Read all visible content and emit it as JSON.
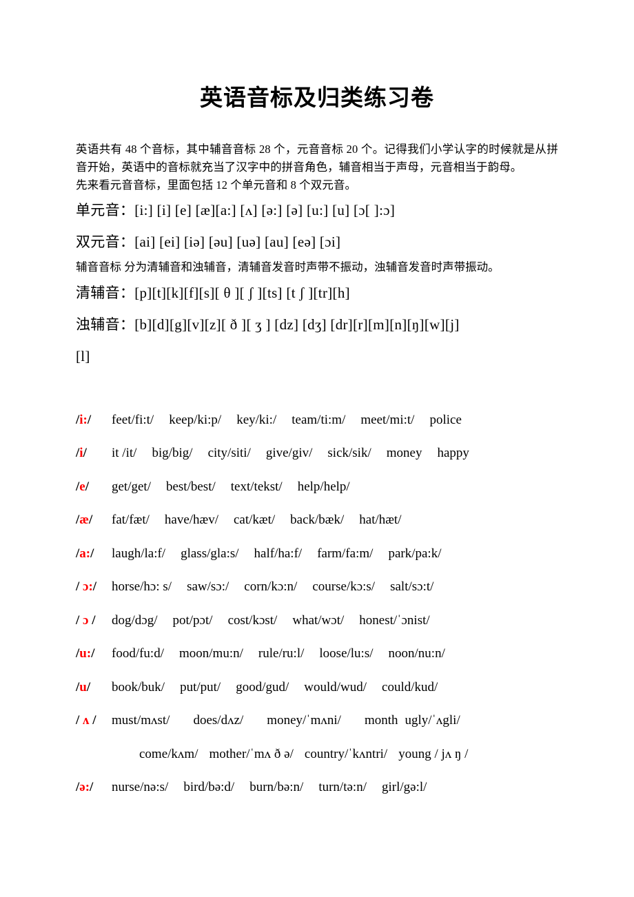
{
  "document": {
    "title": "英语音标及归类练习卷",
    "intro": [
      "英语共有 48 个音标，其中辅音音标 28 个，元音音标 20 个。记得我们小学认字的时候就是从拼音开始，英语中的音标就充当了汉字中的拼音角色，辅音相当于声母，元音相当于韵母。",
      "先来看元音音标，里面包括 12 个单元音和 8 个双元音。"
    ],
    "ipa_groups": [
      {
        "label": "单元音：",
        "symbols": "[i:]  [i]  [e]  [æ][a:]  [ʌ]  [ə:]  [ə]  [u:]  [u]  [ɔ[ ]:ɔ]"
      },
      {
        "label": "双元音：",
        "symbols": "[ai]  [ei]  [iə]  [əu]  [uə]  [au]  [eə]  [ɔi]"
      }
    ],
    "consonant_note": "辅音音标 分为清辅音和浊辅音，清辅音发音时声带不振动，浊辅音发音时声带振动。",
    "consonant_groups": [
      {
        "label": "清辅音：",
        "symbols": "[p][t][k][f][s][ θ ][ ʃ ][ts]  [t ʃ ][tr][h]"
      },
      {
        "label": "浊辅音：",
        "symbols": "[b][d][g][v][z][ ð ][ ʒ ]  [dz]  [dʒ]  [dr][r][m][n][ŋ][w][j]",
        "continuation": "[l]"
      }
    ],
    "word_rows": [
      {
        "symbol_open": "/",
        "symbol": "i:",
        "symbol_close": "/",
        "words": [
          "feet/fi:t/",
          "keep/ki:p/",
          "key/ki:/",
          "team/ti:m/",
          "meet/mi:t/",
          "police"
        ]
      },
      {
        "symbol_open": "/",
        "symbol": "i",
        "symbol_close": "/",
        "words": [
          "it /it/",
          "big/big/",
          "city/siti/",
          "give/giv/",
          "sick/sik/",
          "money",
          "happy"
        ]
      },
      {
        "symbol_open": "/",
        "symbol": "e",
        "symbol_close": "/",
        "words": [
          "get/get/",
          "best/best/",
          "text/tekst/",
          "help/help/"
        ]
      },
      {
        "symbol_open": "/",
        "symbol": "æ",
        "symbol_close": "/",
        "words": [
          "fat/fæt/",
          "have/hæv/",
          "cat/kæt/",
          "back/bæk/",
          "hat/hæt/"
        ]
      },
      {
        "symbol_open": "/",
        "symbol": "a:",
        "symbol_close": "/",
        "words": [
          "laugh/la:f/",
          "glass/gla:s/",
          "half/ha:f/",
          "farm/fa:m/",
          "park/pa:k/"
        ]
      },
      {
        "symbol_open": "/ ",
        "symbol": "ɔ:",
        "symbol_close": "/",
        "words": [
          "horse/hɔ: s/",
          "saw/sɔ:/",
          "corn/kɔ:n/",
          "course/kɔ:s/",
          "salt/sɔ:t/"
        ]
      },
      {
        "symbol_open": "/ ",
        "symbol": "ɔ",
        "symbol_close": " /",
        "words": [
          "dog/dɔg/",
          "pot/pɔt/",
          "cost/kɔst/",
          "what/wɔt/",
          "honest/ˈɔnist/"
        ]
      },
      {
        "symbol_open": "/",
        "symbol": "u:",
        "symbol_close": "/",
        "words": [
          "food/fu:d/",
          "moon/mu:n/",
          "rule/ru:l/",
          "loose/lu:s/",
          "noon/nu:n/"
        ]
      },
      {
        "symbol_open": "/",
        "symbol": "u",
        "symbol_close": "/",
        "words": [
          "book/buk/",
          "put/put/",
          "good/gud/",
          "would/wud/",
          "could/kud/"
        ]
      },
      {
        "symbol_open": "/ ",
        "symbol": "ʌ",
        "symbol_close": " /",
        "words": [
          "must/mʌst/",
          "does/dʌz/",
          "money/ˈmʌni/",
          "month",
          "ugly/ˈʌgli/"
        ]
      },
      {
        "symbol_open": "/",
        "symbol": "ə:",
        "symbol_close": "/",
        "words": [
          "nurse/nə:s/",
          "bird/bə:d/",
          "burn/bə:n/",
          "turn/tə:n/",
          "girl/gə:l/"
        ]
      }
    ],
    "continuation_row": {
      "words": [
        "come/kʌm/",
        "mother/ˈmʌ ð ə/",
        "country/ˈkʌntri/",
        "young / jʌ ŋ /"
      ]
    },
    "colors": {
      "phonetic_red": "#ff0000",
      "text_black": "#000000",
      "page_background": "#ffffff"
    }
  }
}
